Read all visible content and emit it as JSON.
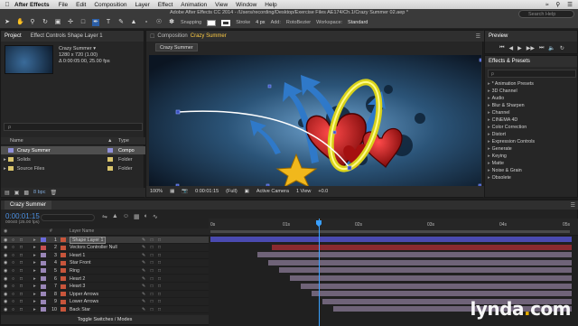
{
  "menubar": {
    "app": "After Effects",
    "items": [
      "File",
      "Edit",
      "Composition",
      "Layer",
      "Effect",
      "Animation",
      "View",
      "Window",
      "Help"
    ]
  },
  "window_title": "Adobe After Effects CC 2014 - /Users/recording/Desktop/Exercise Files AE174/Ch.1/Crazy Summer 02.aep *",
  "toolbar": {
    "snapping_label": "Snapping",
    "stroke_label": "Stroke",
    "stroke_value": "4 px",
    "add_label": "Add:",
    "rotobezier_label": "RotoBezier",
    "workspace_label": "Workspace:",
    "workspace_value": "Standard",
    "search_placeholder": "Search Help"
  },
  "project": {
    "tab_label": "Project",
    "effect_controls_label": "Effect Controls Shape Layer 1",
    "comp_name": "Crazy Summer ▾",
    "comp_size": "1280 x 720 (1.00)",
    "comp_duration": "Δ 0:00:05:00, 25.00 fps",
    "search_placeholder": "ρ",
    "col_name": "Name",
    "col_type": "Type",
    "rows": [
      {
        "name": "Crazy Summer",
        "type": "Compo",
        "color": "#8f8fd9"
      },
      {
        "name": "Solids",
        "type": "Folder",
        "color": "#d9c46c"
      },
      {
        "name": "Source Files",
        "type": "Folder",
        "color": "#d9c46c"
      }
    ],
    "bpc": "8 bpc"
  },
  "composition": {
    "tab_prefix": "Composition",
    "tab_name": "Crazy Summer",
    "breadcrumb": "Crazy Summer",
    "footer": {
      "zoom": "100%",
      "timecode": "0:00:01:15",
      "resolution": "(Full)",
      "camera": "Active Camera",
      "views": "1 View",
      "exposure": "+0.0"
    }
  },
  "preview": {
    "tab_label": "Preview"
  },
  "effects": {
    "tab_label": "Effects & Presets",
    "search_placeholder": "ρ",
    "items": [
      "* Animation Presets",
      "3D Channel",
      "Audio",
      "Blur & Sharpen",
      "Channel",
      "CINEMA 4D",
      "Color Correction",
      "Distort",
      "Expression Controls",
      "Generate",
      "Keying",
      "Matte",
      "Noise & Grain",
      "Obsolete"
    ]
  },
  "timeline": {
    "tab_label": "Crazy Summer",
    "timecode": "0:00:01:15",
    "fps_label": "00040 (25.00 fps)",
    "layer_name_header": "Layer Name",
    "toggle_label": "Toggle Switches / Modes",
    "ruler_labels": [
      "0s",
      "01s",
      "02s",
      "03s",
      "04s",
      "05s"
    ],
    "current_time_fraction": 0.3,
    "layers": [
      {
        "num": "1",
        "name": "Shape Layer 1",
        "label": "#6a6adb",
        "start": 0.0,
        "end": 1.0,
        "bar": "#4a4ab0",
        "selected": true
      },
      {
        "num": "2",
        "name": "Vectors Controller Null",
        "label": "#c85050",
        "start": 0.17,
        "end": 1.0,
        "bar": "#8a2a30",
        "selected": false
      },
      {
        "num": "3",
        "name": "Heart 1",
        "label": "#9a86b8",
        "start": 0.13,
        "end": 1.0,
        "bar": "#6f6378",
        "selected": false
      },
      {
        "num": "4",
        "name": "Star Front",
        "label": "#9a86b8",
        "start": 0.16,
        "end": 1.0,
        "bar": "#6f6378",
        "selected": false
      },
      {
        "num": "5",
        "name": "Ring",
        "label": "#9a86b8",
        "start": 0.19,
        "end": 1.0,
        "bar": "#6f6378",
        "selected": false
      },
      {
        "num": "6",
        "name": "Heart 2",
        "label": "#9a86b8",
        "start": 0.22,
        "end": 1.0,
        "bar": "#6f6378",
        "selected": false
      },
      {
        "num": "7",
        "name": "Heart 3",
        "label": "#9a86b8",
        "start": 0.25,
        "end": 1.0,
        "bar": "#6f6378",
        "selected": false
      },
      {
        "num": "8",
        "name": "Upper Arrows",
        "label": "#9a86b8",
        "start": 0.28,
        "end": 1.0,
        "bar": "#6f6378",
        "selected": false
      },
      {
        "num": "9",
        "name": "Lower Arrows",
        "label": "#9a86b8",
        "start": 0.31,
        "end": 1.0,
        "bar": "#6f6378",
        "selected": false
      },
      {
        "num": "10",
        "name": "Back Star",
        "label": "#9a86b8",
        "start": 0.34,
        "end": 1.0,
        "bar": "#6f6378",
        "selected": false
      }
    ]
  },
  "watermark": {
    "text": "lynda",
    "dot": ".",
    "suffix": "com"
  }
}
